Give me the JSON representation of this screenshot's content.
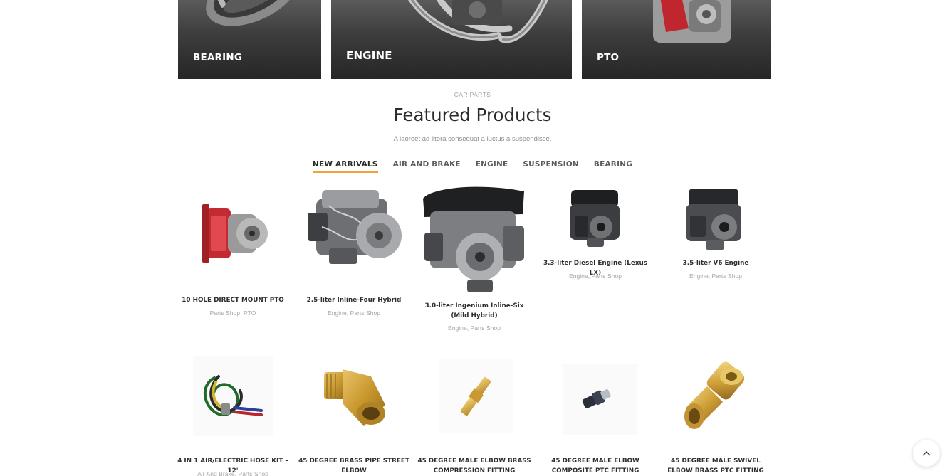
{
  "banners": {
    "bearing": "BEARING",
    "engine": "ENGINE",
    "pto": "PTO"
  },
  "section": {
    "eyebrow": "CAR PARTS",
    "title": "Featured Products",
    "subtitle": "A laoreet ad litora consequat a luctus a suspendisse."
  },
  "tabs": [
    "NEW ARRIVALS",
    "AIR AND BRAKE",
    "ENGINE",
    "SUSPENSION",
    "BEARING"
  ],
  "products": [
    {
      "name": "10 HOLE DIRECT MOUNT PTO",
      "categories": "Parts Shop, PTO"
    },
    {
      "name": "2.5-liter Inline-Four Hybrid",
      "categories": "Engine, Parts Shop"
    },
    {
      "name": "3.0-liter Ingenium Inline-Six (Mild Hybrid)",
      "categories": "Engine, Parts Shop"
    },
    {
      "name": "3.3-liter Diesel Engine (Lexus LX)",
      "categories": "Engine, Parts Shop"
    },
    {
      "name": "3.5-liter V6 Engine",
      "categories": "Engine, Parts Shop"
    },
    {
      "name": "4 IN 1 AIR/ELECTRIC HOSE KIT – 12'",
      "categories": "Air And Brake, Parts Shop"
    },
    {
      "name": "45 DEGREE BRASS PIPE STREET ELBOW",
      "categories": ""
    },
    {
      "name": "45 DEGREE MALE ELBOW BRASS COMPRESSION FITTING",
      "categories": ""
    },
    {
      "name": "45 DEGREE MALE ELBOW COMPOSITE PTC FITTING",
      "categories": ""
    },
    {
      "name": "45 DEGREE MALE SWIVEL ELBOW BRASS PTC FITTING",
      "categories": ""
    }
  ],
  "colors": {
    "accent": "#f2a23a",
    "banner_dark": "#262626",
    "pto_red": "#c0262d",
    "brass": "#c9982e"
  },
  "icons": {
    "scroll_top": "chevron-up-icon"
  }
}
